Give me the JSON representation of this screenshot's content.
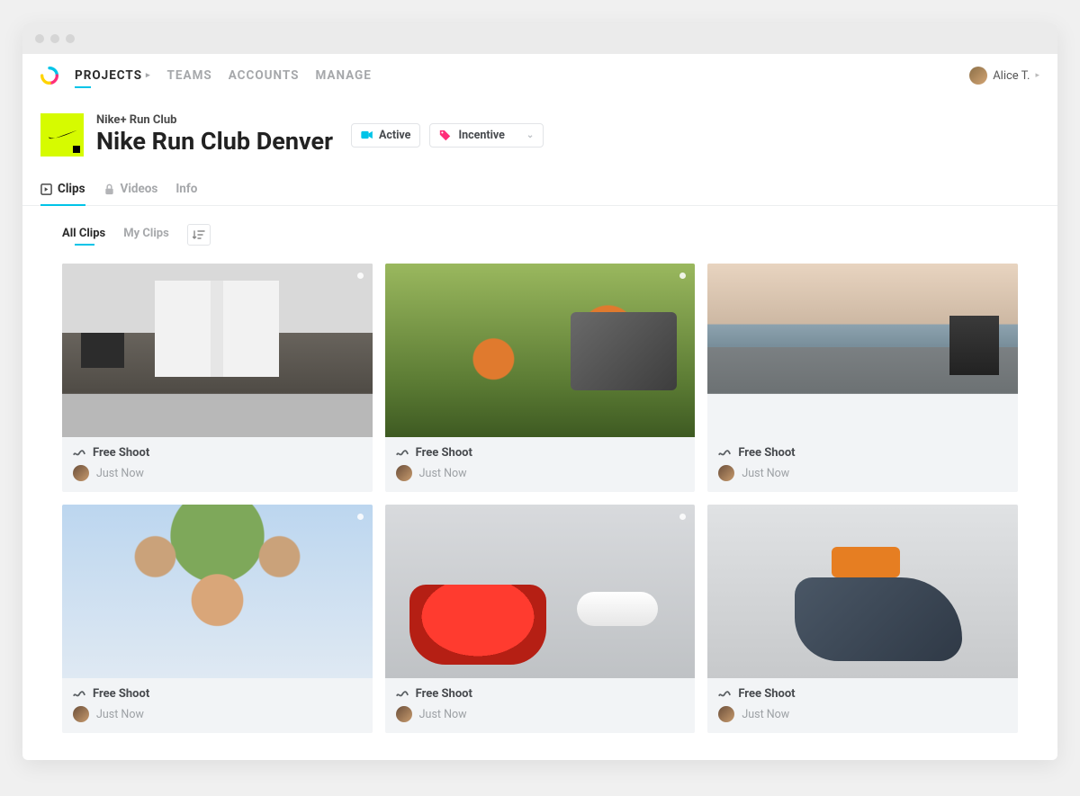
{
  "nav": {
    "items": [
      {
        "label": "PROJECTS",
        "active": true,
        "caret": true
      },
      {
        "label": "TEAMS"
      },
      {
        "label": "ACCOUNTS"
      },
      {
        "label": "MANAGE"
      }
    ],
    "user_name": "Alice T."
  },
  "project": {
    "parent": "Nike+ Run Club",
    "title": "Nike Run Club Denver",
    "status": "Active",
    "tag": "Incentive"
  },
  "tabs": [
    {
      "label": "Clips",
      "active": true
    },
    {
      "label": "Videos"
    },
    {
      "label": "Info"
    }
  ],
  "filters": {
    "all": "All Clips",
    "mine": "My Clips"
  },
  "clips": [
    {
      "title": "Free Shoot",
      "time": "Just Now",
      "marker": true,
      "scene": "sc-room"
    },
    {
      "title": "Free Shoot",
      "time": "Just Now",
      "marker": true,
      "scene": "sc-grass"
    },
    {
      "title": "Free Shoot",
      "time": "Just Now",
      "marker": false,
      "scene": "sc-lake"
    },
    {
      "title": "Free Shoot",
      "time": "Just Now",
      "marker": true,
      "scene": "sc-hands"
    },
    {
      "title": "Free Shoot",
      "time": "Just Now",
      "marker": true,
      "scene": "sc-red"
    },
    {
      "title": "Free Shoot",
      "time": "Just Now",
      "marker": false,
      "scene": "sc-tie"
    }
  ]
}
